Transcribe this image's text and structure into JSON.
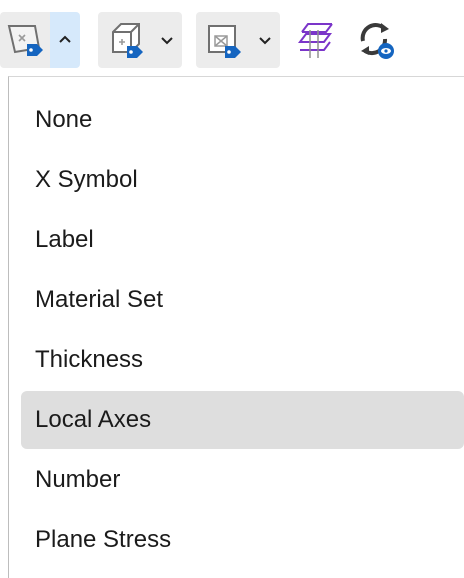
{
  "toolbar": {
    "buttons": [
      {
        "icon": "plate-label-icon",
        "chevron": "chevron-up-icon",
        "open": true
      },
      {
        "icon": "cube-display-icon",
        "chevron": "chevron-down-icon",
        "open": false
      },
      {
        "icon": "element-filter-icon",
        "chevron": "chevron-down-icon",
        "open": false
      },
      {
        "icon": "grid-layers-icon"
      },
      {
        "icon": "refresh-view-icon"
      }
    ],
    "colors": {
      "accent_blue": "#1565c0",
      "purple": "#7b35c9",
      "active_chevron_bg": "#d6e9fb",
      "button_bg": "#ececec"
    }
  },
  "menu": {
    "items": [
      {
        "label": "None"
      },
      {
        "label": "X Symbol"
      },
      {
        "label": "Label"
      },
      {
        "label": "Material Set"
      },
      {
        "label": "Thickness"
      },
      {
        "label": "Local Axes"
      },
      {
        "label": "Number"
      },
      {
        "label": "Plane Stress"
      }
    ],
    "selected": "Local Axes",
    "highlight_color": "#dedede"
  }
}
